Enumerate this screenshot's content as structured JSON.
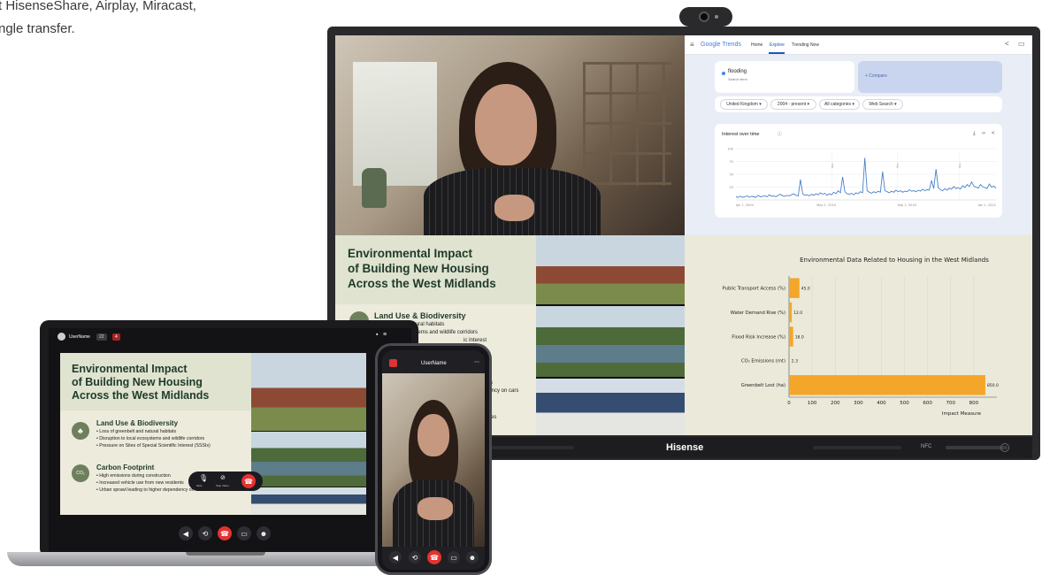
{
  "intro": {
    "line1": "t HisenseShare, Airplay, Miracast,",
    "line2": "ngle transfer."
  },
  "tv": {
    "brand": "Hisense",
    "nfc": "NFC"
  },
  "trends": {
    "logo": "Google Trends",
    "nav": [
      "Home",
      "Explore",
      "Trending Now"
    ],
    "term": "flooding",
    "term_sub": "Search term",
    "compare": "+ Compare",
    "filters": [
      "United Kingdom ▾",
      "2004 - present ▾",
      "All categories ▾",
      "Web Search ▾"
    ],
    "chart_title": "Interest over time",
    "x_labels": [
      "Jan 1, 2004",
      "May 1, 2010",
      "Sep 1, 2016",
      "Jan 1, 2022"
    ],
    "y_labels": [
      "100",
      "75",
      "50",
      "25"
    ],
    "note": "Note",
    "chart_data": {
      "type": "line",
      "y": [
        6,
        5,
        7,
        5,
        6,
        8,
        5,
        7,
        6,
        5,
        9,
        6,
        7,
        8,
        6,
        10,
        7,
        8,
        6,
        9,
        11,
        8,
        7,
        9,
        8,
        10,
        12,
        9,
        8,
        40,
        12,
        9,
        10,
        8,
        11,
        9,
        12,
        10,
        14,
        11,
        13,
        9,
        12,
        10,
        15,
        12,
        18,
        14,
        45,
        16,
        12,
        11,
        13,
        10,
        14,
        12,
        16,
        14,
        82,
        18,
        15,
        13,
        16,
        14,
        17,
        15,
        55,
        18,
        16,
        14,
        17,
        15,
        19,
        16,
        18,
        15,
        17,
        16,
        20,
        17,
        18,
        16,
        19,
        17,
        21,
        18,
        20,
        19,
        38,
        22,
        60,
        24,
        20,
        18,
        22,
        19,
        23,
        21,
        26,
        22,
        24,
        21,
        28,
        24,
        30,
        26,
        35,
        27,
        25,
        23,
        30,
        26,
        24,
        22,
        31,
        25,
        27,
        23
      ],
      "ylim": [
        0,
        100
      ]
    }
  },
  "barchart": {
    "title": "Environmental Data Related to Housing in the West Midlands",
    "xlabel": "Impact Measure",
    "chart_data": {
      "type": "bar",
      "categories": [
        "Public Transport Access (%)",
        "Water Demand Rise (%)",
        "Flood Risk Increase (%)",
        "CO₂ Emissions (mt)",
        "Greenbelt Lost (ha)"
      ],
      "values": [
        45.0,
        12.0,
        18.0,
        2.3,
        850.0
      ],
      "value_labels": [
        "45.0",
        "12.0",
        "18.0",
        "2.3",
        "850.0"
      ],
      "xlim": [
        0,
        900
      ],
      "ticks": [
        "0",
        "100",
        "200",
        "300",
        "400",
        "500",
        "600",
        "700",
        "800"
      ],
      "color": "#f4a62a"
    }
  },
  "slide": {
    "title1": "Environmental Impact",
    "title2": "of Building New Housing",
    "title3": "Across the West Midlands",
    "h1": "Land Use & Biodiversity",
    "b1": [
      "• Loss of greenbelt and natural habitats",
      "• Disruption to local ecosystems and wildlife corridors",
      "• Pressure on Sites of Special Scientific Interest (SSSIs)"
    ],
    "h2": "Carbon Footprint",
    "b2": [
      "• High emissions during construction",
      "• Increased vehicle use from new residents",
      "• Urban sprawl leading to higher dependency on cars"
    ]
  },
  "tv_slide_partials": {
    "l1": "greenbelt and natural habitats",
    "l2": "on to local ecosystems and wildlife corridors",
    "l3": "ic Interest",
    "l4": "nts",
    "l5": "dency on cars",
    "l6": "sites"
  },
  "laptop": {
    "user": "UserName",
    "badge1": "22",
    "badge2": "4",
    "mute": "Mute",
    "stop_video": "Stop Video"
  },
  "phone": {
    "user": "UserName"
  }
}
